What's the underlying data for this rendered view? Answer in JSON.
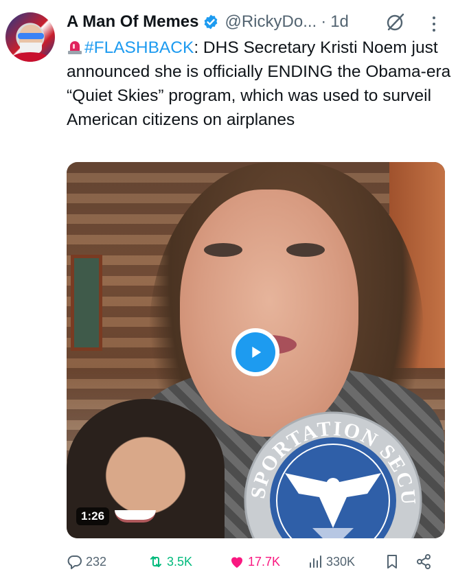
{
  "tweet": {
    "display_name": "A Man Of Memes",
    "handle": "@RickyDo...",
    "separator": "·",
    "time": "1d",
    "text": {
      "hashtag": "#FLASHBACK",
      "body": ": DHS Secretary Kristi Noem just announced she is officially ENDING the Obama-era “Quiet Skies” program, which was used to surveil American  citizens on airplanes"
    }
  },
  "media": {
    "duration": "1:26",
    "seal_text": "TRANSPORTATION SECURITY"
  },
  "actions": {
    "replies": "232",
    "reposts": "3.5K",
    "likes": "17.7K",
    "views": "330K"
  },
  "colors": {
    "accent": "#1d9bf0",
    "repost_green": "#00ba7c",
    "like_pink": "#f91880",
    "muted": "#536471",
    "text": "#0f1419"
  },
  "icons": [
    "verified-badge-icon",
    "grok-icon",
    "more-icon",
    "siren-emoji-icon",
    "play-icon",
    "reply-icon",
    "repost-icon",
    "like-icon",
    "views-icon",
    "bookmark-icon",
    "share-icon"
  ]
}
